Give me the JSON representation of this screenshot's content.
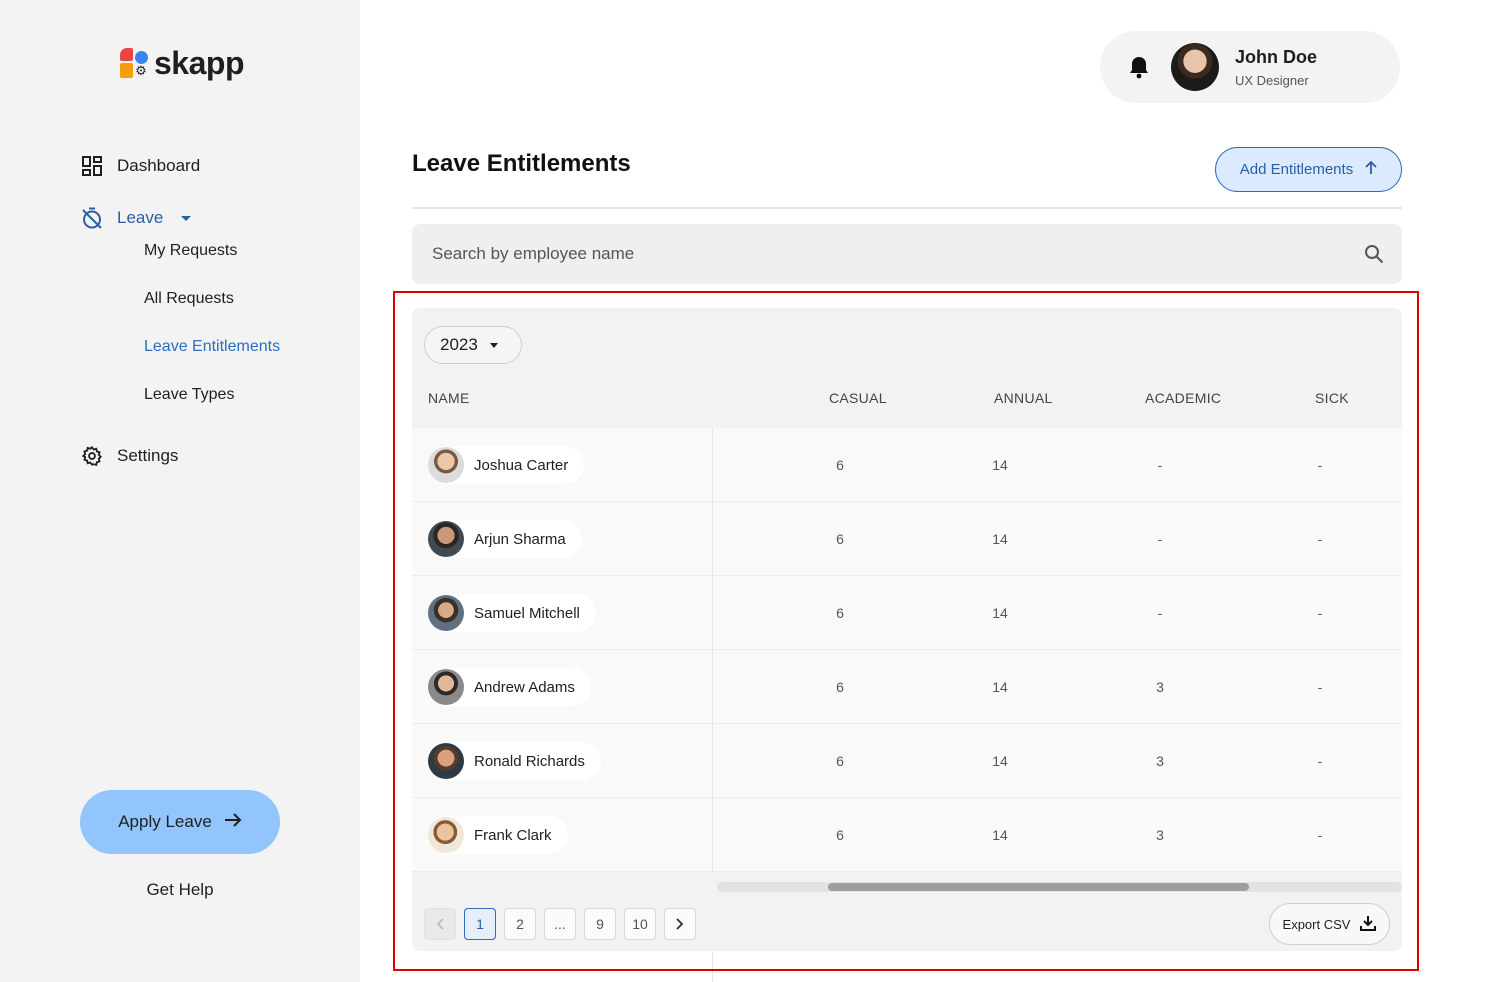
{
  "app": {
    "name": "skapp"
  },
  "sidebar": {
    "nav": {
      "dashboard": "Dashboard",
      "leave": "Leave",
      "settings": "Settings"
    },
    "leave_sub": [
      "My Requests",
      "All Requests",
      "Leave Entitlements",
      "Leave Types"
    ],
    "active_sub": "Leave Entitlements",
    "apply_button": "Apply Leave",
    "help_link": "Get Help"
  },
  "header": {
    "user_name": "John Doe",
    "user_role": "UX Designer"
  },
  "page": {
    "title": "Leave Entitlements",
    "add_button": "Add Entitlements",
    "search_placeholder": "Search by employee name"
  },
  "table": {
    "year": "2023",
    "columns": [
      "NAME",
      "CASUAL",
      "ANNUAL",
      "ACADEMIC",
      "SICK"
    ],
    "rows": [
      {
        "name": "Joshua Carter",
        "casual": "6",
        "annual": "14",
        "academic": "-",
        "sick": "-"
      },
      {
        "name": "Arjun Sharma",
        "casual": "6",
        "annual": "14",
        "academic": "-",
        "sick": "-"
      },
      {
        "name": "Samuel Mitchell",
        "casual": "6",
        "annual": "14",
        "academic": "-",
        "sick": "-"
      },
      {
        "name": "Andrew Adams",
        "casual": "6",
        "annual": "14",
        "academic": "3",
        "sick": "-"
      },
      {
        "name": "Ronald Richards",
        "casual": "6",
        "annual": "14",
        "academic": "3",
        "sick": "-"
      },
      {
        "name": "Frank Clark",
        "casual": "6",
        "annual": "14",
        "academic": "3",
        "sick": "-"
      }
    ],
    "pagination": [
      "1",
      "2",
      "...",
      "9",
      "10"
    ],
    "current_page": "1",
    "export_button": "Export CSV"
  },
  "colors": {
    "accent": "#2a6ec0",
    "apply_button_bg": "#93c5fd",
    "highlight_frame": "#e00000"
  }
}
